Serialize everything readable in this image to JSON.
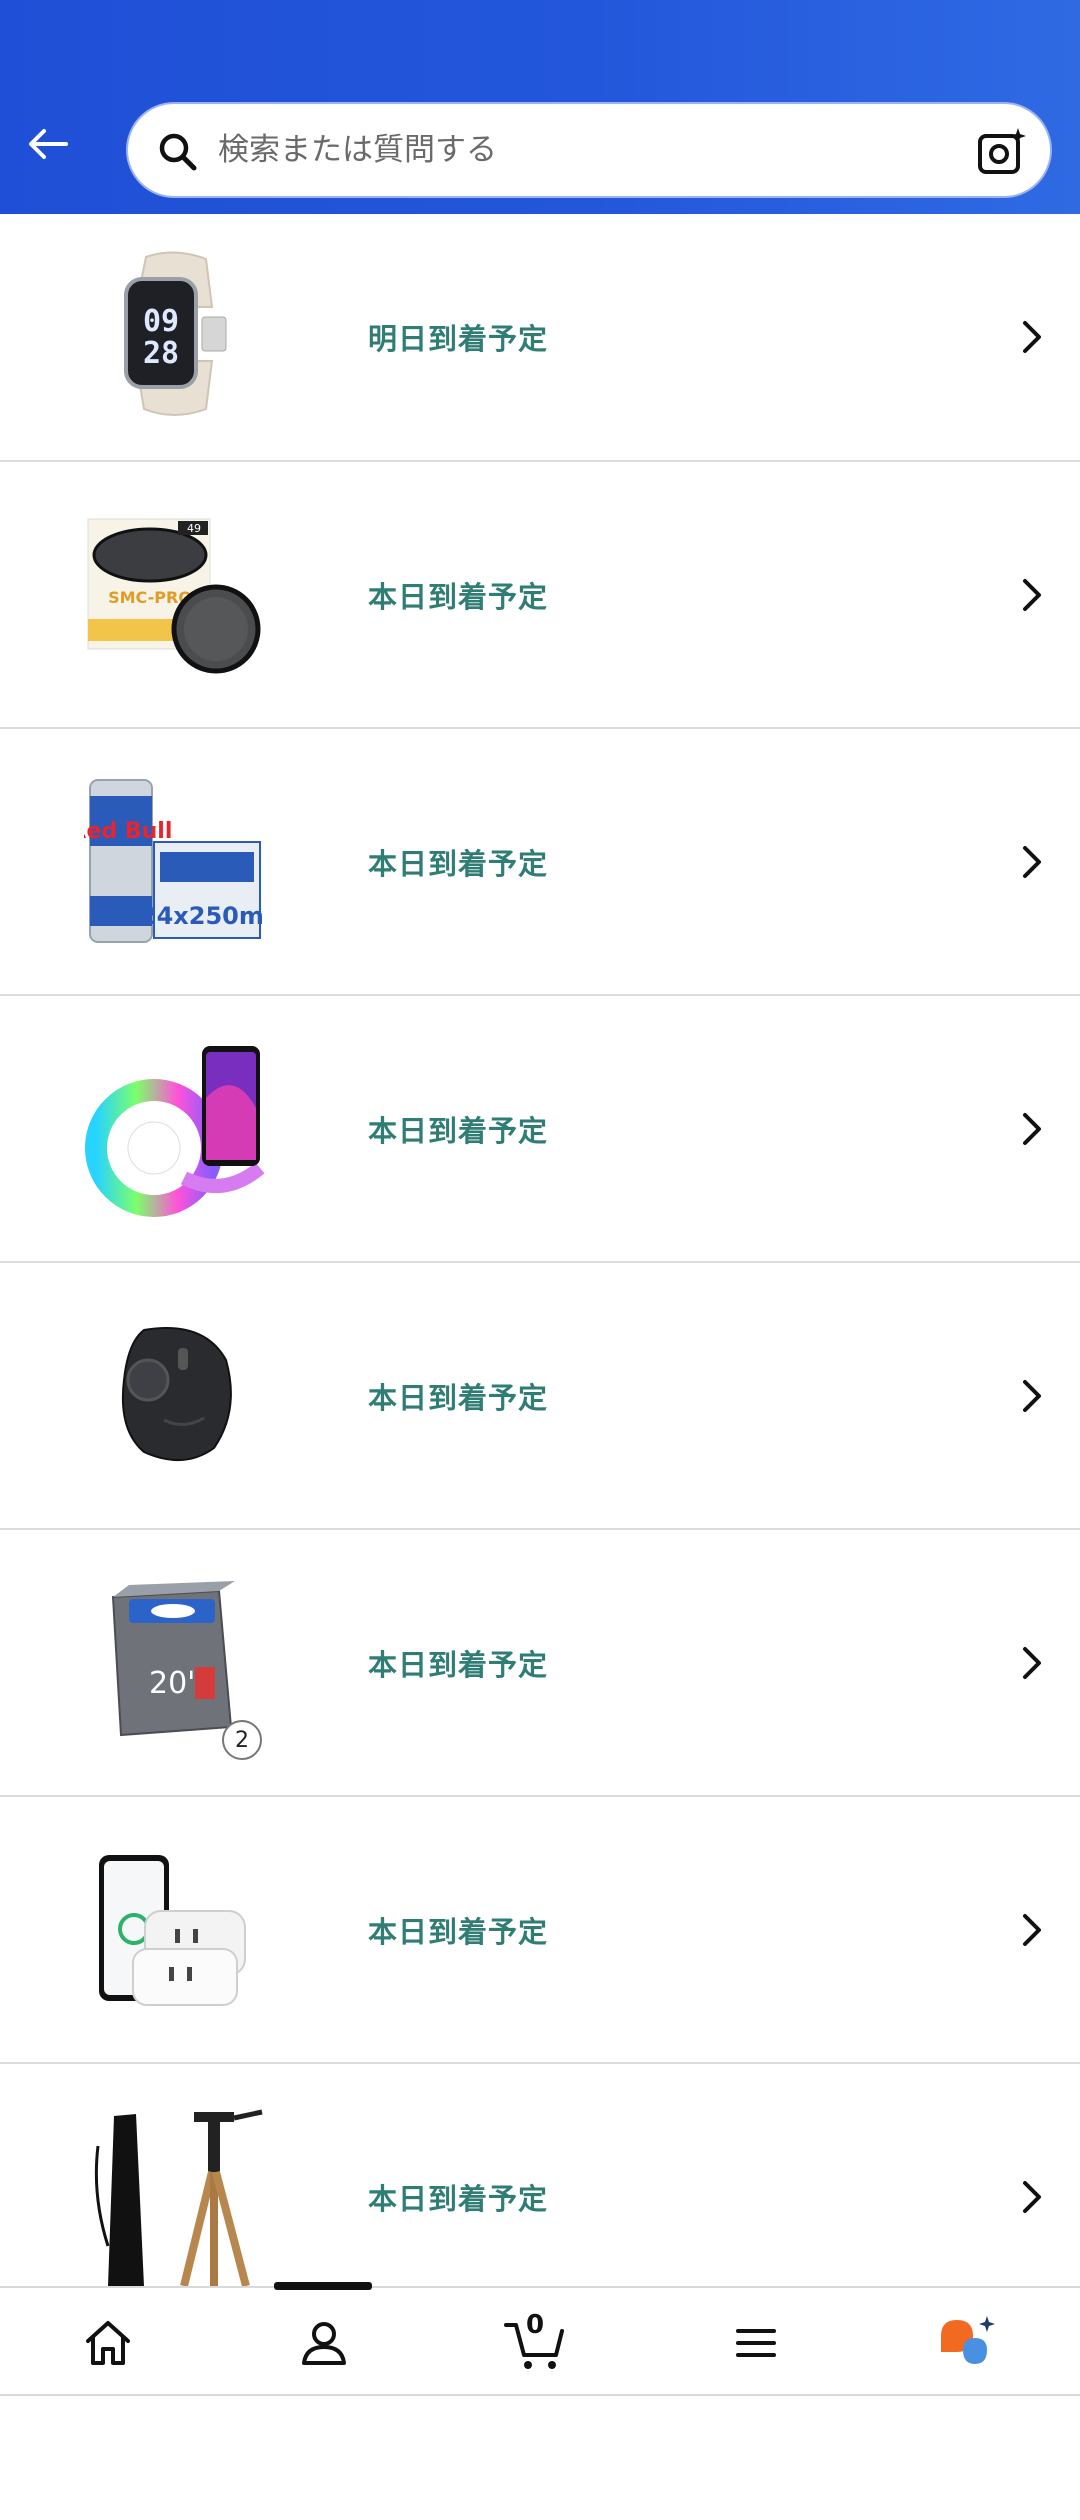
{
  "header": {
    "search_placeholder": "検索または質問する",
    "accent_color": "#2357db"
  },
  "orders": [
    {
      "label": "明日到着予定",
      "image": "smartwatch-product-image"
    },
    {
      "label": "本日到着予定",
      "image": "camera-filter-product-image"
    },
    {
      "label": "本日到着予定",
      "image": "energy-drink-product-image"
    },
    {
      "label": "本日到着予定",
      "image": "led-strip-product-image"
    },
    {
      "label": "本日到着予定",
      "image": "trackball-mouse-product-image",
      "quantity": ""
    },
    {
      "label": "本日到着予定",
      "image": "bicycle-tube-product-image",
      "quantity": "2"
    },
    {
      "label": "本日到着予定",
      "image": "smart-plug-product-image"
    },
    {
      "label": "本日到着予定",
      "image": "tripod-product-image"
    }
  ],
  "nav": {
    "items": [
      "home-icon",
      "account-icon",
      "cart-icon",
      "menu-icon",
      "assistant-icon"
    ],
    "cart_count": "0"
  }
}
